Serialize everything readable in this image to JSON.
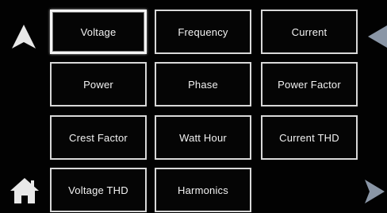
{
  "menu": {
    "items": [
      {
        "label": "Voltage",
        "selected": true
      },
      {
        "label": "Frequency",
        "selected": false
      },
      {
        "label": "Current",
        "selected": false
      },
      {
        "label": "Power",
        "selected": false
      },
      {
        "label": "Phase",
        "selected": false
      },
      {
        "label": "Power Factor",
        "selected": false
      },
      {
        "label": "Crest Factor",
        "selected": false
      },
      {
        "label": "Watt Hour",
        "selected": false
      },
      {
        "label": "Current THD",
        "selected": false
      },
      {
        "label": "Voltage THD",
        "selected": false
      },
      {
        "label": "Harmonics",
        "selected": false
      }
    ]
  },
  "nav": {
    "up_icon": "arrow-up-icon",
    "back_icon": "arrow-left-icon",
    "home_icon": "home-icon",
    "next_icon": "arrow-right-icon"
  },
  "colors": {
    "background": "#000000",
    "tile_border": "#d8d8d8",
    "text": "#f2f2f2",
    "icon": "#e8e8e8",
    "side_arrow": "#8a96a6"
  }
}
